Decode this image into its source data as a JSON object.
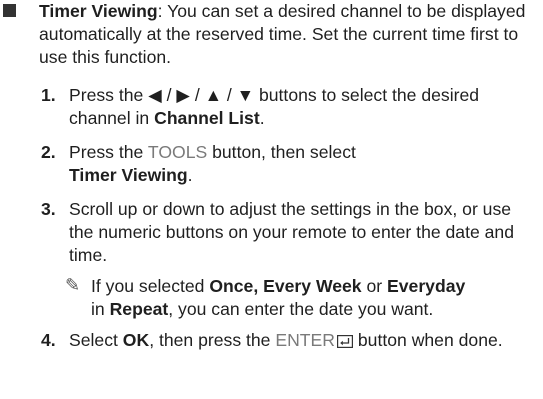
{
  "intro": {
    "title": "Timer Viewing",
    "text": ": You can set a desired channel to be displayed automatically at the reserved time. Set the current time first to use this function."
  },
  "steps": [
    {
      "num": "1.",
      "a": "Press the ◀ / ▶ / ▲ / ▼ buttons to select the desired channel in ",
      "b": "Channel List",
      "c": "."
    },
    {
      "num": "2.",
      "a": "Press the ",
      "key": "TOOLS",
      "b": " button, then select ",
      "c": "Timer Viewing",
      "d": "."
    },
    {
      "num": "3.",
      "a": "Scroll up or down to adjust the settings in the box, or use the numeric buttons on your remote to enter the date and time."
    },
    {
      "num": "4.",
      "a": "Select ",
      "b": "OK",
      "c": ", then press the ",
      "key": "ENTER",
      "d": " button when done."
    }
  ],
  "note": {
    "a": "If you selected ",
    "b": "Once, Every Week",
    "c": " or ",
    "d": "Everyday",
    "e": " in ",
    "f": "Repeat",
    "g": ", you can enter the date you want."
  }
}
